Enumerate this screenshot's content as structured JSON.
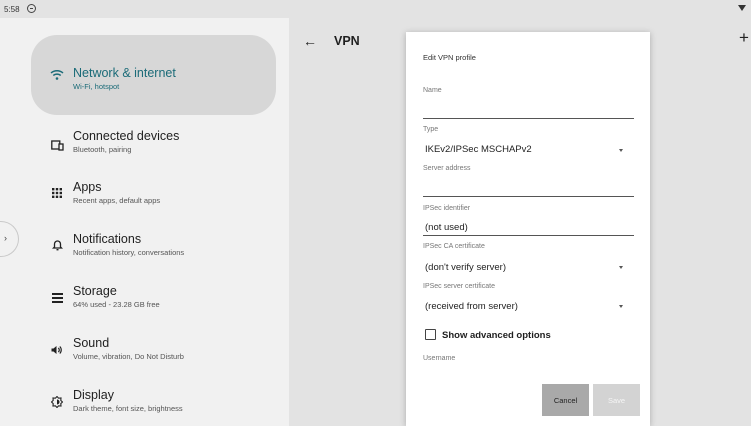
{
  "status_bar": {
    "time": "5:58"
  },
  "sidebar": {
    "handle_glyph": "›",
    "items": [
      {
        "icon": "wifi-icon",
        "title": "Network & internet",
        "subtitle": "Wi-Fi, hotspot",
        "selected": true
      },
      {
        "icon": "devices-icon",
        "title": "Connected devices",
        "subtitle": "Bluetooth, pairing"
      },
      {
        "icon": "apps-icon",
        "title": "Apps",
        "subtitle": "Recent apps, default apps"
      },
      {
        "icon": "bell-icon",
        "title": "Notifications",
        "subtitle": "Notification history, conversations"
      },
      {
        "icon": "storage-icon",
        "title": "Storage",
        "subtitle": "64% used - 23.28 GB free"
      },
      {
        "icon": "volume-icon",
        "title": "Sound",
        "subtitle": "Volume, vibration, Do Not Disturb"
      },
      {
        "icon": "brightness-icon",
        "title": "Display",
        "subtitle": "Dark theme, font size, brightness"
      }
    ]
  },
  "header": {
    "back_glyph": "←",
    "title": "VPN",
    "add_glyph": "+"
  },
  "dialog": {
    "title": "Edit VPN profile",
    "name_label": "Name",
    "name_value": "",
    "type_label": "Type",
    "type_value": "IKEv2/IPSec MSCHAPv2",
    "server_label": "Server address",
    "server_value": "",
    "ipsec_id_label": "IPSec identifier",
    "ipsec_id_value": "(not used)",
    "ca_cert_label": "IPSec CA certificate",
    "ca_cert_value": "(don't verify server)",
    "server_cert_label": "IPSec server certificate",
    "server_cert_value": "(received from server)",
    "advanced_label": "Show advanced options",
    "advanced_checked": false,
    "username_label": "Username",
    "cancel_label": "Cancel",
    "save_label": "Save"
  },
  "colors": {
    "accent": "#1b6b78",
    "selected_bg": "#d7d7d7"
  }
}
